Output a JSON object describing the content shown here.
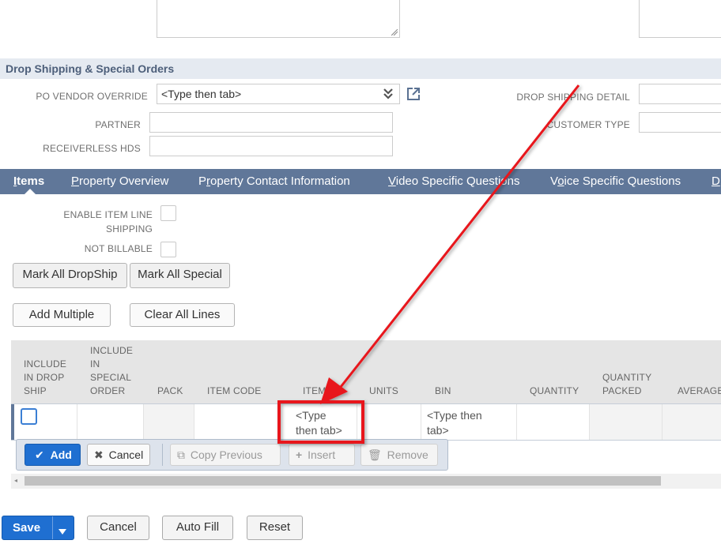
{
  "section": {
    "title": "Drop Shipping & Special Orders"
  },
  "fields": {
    "po_vendor_override": {
      "label": "PO VENDOR OVERRIDE",
      "value": "<Type then tab>"
    },
    "partner": {
      "label": "PARTNER",
      "value": ""
    },
    "receiverless_hds": {
      "label": "RECEIVERLESS HDS",
      "value": ""
    },
    "drop_shipping_detail": {
      "label": "DROP SHIPPING DETAIL",
      "value": ""
    },
    "customer_type": {
      "label": "CUSTOMER TYPE",
      "value": ""
    }
  },
  "tabs": [
    {
      "prefix": "",
      "underline": "I",
      "rest": "tems",
      "active": true
    },
    {
      "prefix": "",
      "underline": "P",
      "rest": "roperty Overview",
      "active": false
    },
    {
      "prefix": "P",
      "underline": "r",
      "rest": "operty Contact Information",
      "active": false
    },
    {
      "prefix": "",
      "underline": "V",
      "rest": "ideo Specific Questions",
      "active": false
    },
    {
      "prefix": "V",
      "underline": "o",
      "rest": "ice Specific Questions",
      "active": false
    },
    {
      "prefix": "",
      "underline": "D",
      "rest": "",
      "active": false
    }
  ],
  "items_options": {
    "enable_item_line_shipping": {
      "label_line1": "ENABLE ITEM LINE",
      "label_line2": "SHIPPING",
      "checked": false
    },
    "not_billable": {
      "label": "NOT BILLABLE",
      "checked": false
    }
  },
  "buttons": {
    "mark_all_dropship": "Mark All DropShip",
    "mark_all_special": "Mark All Special",
    "add_multiple": "Add Multiple",
    "clear_all_lines": "Clear All Lines"
  },
  "grid": {
    "columns": {
      "include_drop_ship": [
        "INCLUDE",
        "IN DROP",
        "SHIP"
      ],
      "include_special_order": [
        "INCLUDE",
        "IN",
        "SPECIAL",
        "ORDER"
      ],
      "pack": "PACK",
      "item_code": "ITEM CODE",
      "item": "ITEM",
      "units": "UNITS",
      "bin": "BIN",
      "quantity": "QUANTITY",
      "quantity_packed": [
        "QUANTITY",
        "PACKED"
      ],
      "average": "AVERAGE"
    },
    "row": {
      "item_placeholder_1": "<Type",
      "item_placeholder_2": "then tab>",
      "bin_placeholder_1": "<Type then",
      "bin_placeholder_2": "tab>"
    },
    "toolbar": {
      "add": "Add",
      "cancel": "Cancel",
      "copy_previous": "Copy Previous",
      "insert": "Insert",
      "remove": "Remove"
    }
  },
  "footer": {
    "save": "Save",
    "cancel": "Cancel",
    "auto_fill": "Auto Fill",
    "reset": "Reset"
  },
  "colors": {
    "tabbar": "#607799",
    "section_header_bg": "#e5eaf1",
    "primary_button": "#1f6fd1",
    "annotation_red": "#e8161b"
  },
  "annotation": {
    "shape": "red-arrow-and-box",
    "target": "item-cell"
  }
}
